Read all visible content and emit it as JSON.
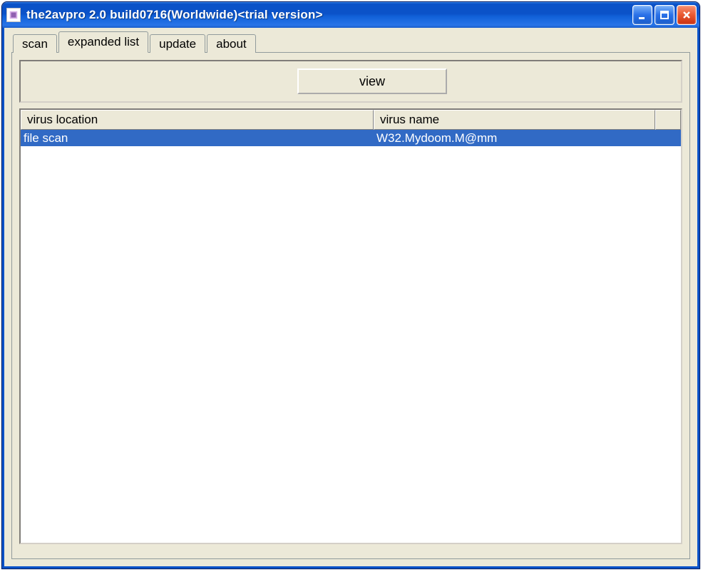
{
  "window": {
    "title": "the2avpro 2.0 build0716(Worldwide)<trial version>"
  },
  "tabs": [
    {
      "label": "scan",
      "active": false
    },
    {
      "label": "expanded list",
      "active": true
    },
    {
      "label": "update",
      "active": false
    },
    {
      "label": "about",
      "active": false
    }
  ],
  "toolbar": {
    "view_label": "view"
  },
  "list": {
    "columns": [
      {
        "label": "virus location"
      },
      {
        "label": "virus name"
      }
    ],
    "rows": [
      {
        "location": "file scan",
        "name": "W32.Mydoom.M@mm",
        "selected": true
      }
    ]
  }
}
